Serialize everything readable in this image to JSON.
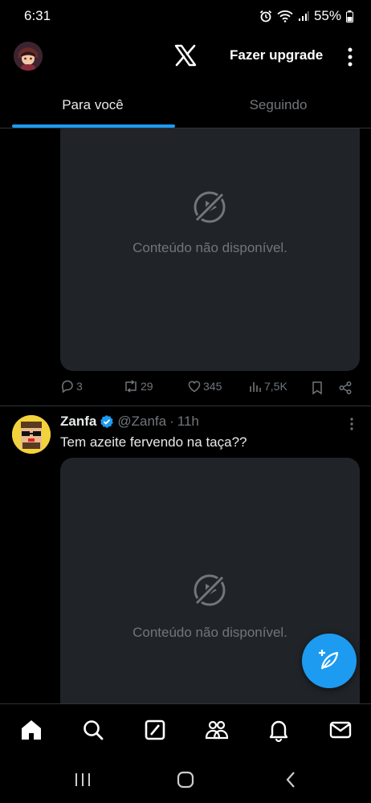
{
  "status_bar": {
    "time": "6:31",
    "battery": "55%"
  },
  "header": {
    "logo_icon": "x-logo-icon",
    "upgrade_label": "Fazer upgrade"
  },
  "tabs": [
    {
      "label": "Para você",
      "active": true
    },
    {
      "label": "Seguindo",
      "active": false
    }
  ],
  "feed": {
    "first_post": {
      "media_unavailable": "Conteúdo não disponível.",
      "stats": {
        "replies": "3",
        "reposts": "29",
        "likes": "345",
        "views": "7,5K"
      }
    },
    "second_post": {
      "author_name": "Zanfa",
      "handle": "@Zanfa",
      "separator": "·",
      "time": "11h",
      "text": "Tem azeite fervendo na taça??",
      "media_unavailable": "Conteúdo não disponível."
    }
  },
  "bottom_nav": [
    "home-icon",
    "search-icon",
    "grok-icon",
    "communities-icon",
    "notifications-icon",
    "messages-icon"
  ],
  "colors": {
    "accent": "#1d9bf0",
    "background": "#000000",
    "media_placeholder": "#202327",
    "muted_text": "#71767b"
  }
}
